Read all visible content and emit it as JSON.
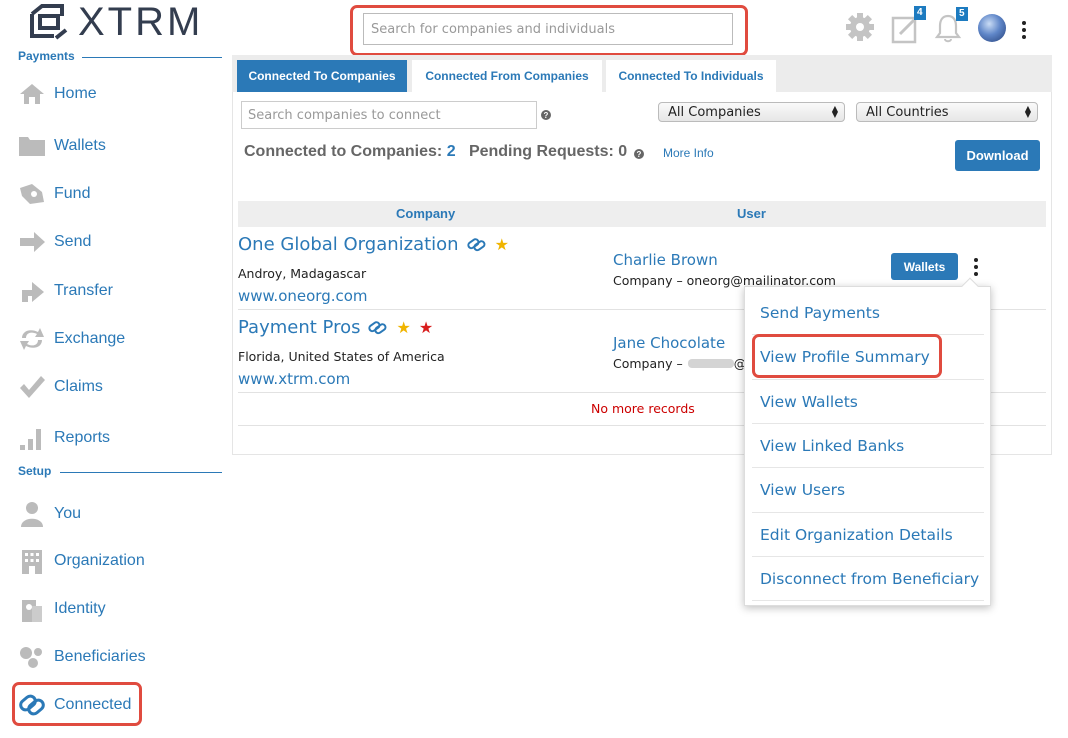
{
  "header": {
    "logo_text": "XTRM",
    "search_placeholder": "Search for companies and individuals",
    "notes_badge": "4",
    "notifications_badge": "5",
    "icons": [
      "gear-icon",
      "notes-icon",
      "bell-icon",
      "avatar",
      "kebab-icon"
    ]
  },
  "sidebar": {
    "payments_title": "Payments",
    "setup_title": "Setup",
    "payments_items": [
      {
        "label": "Home",
        "icon": "home-icon"
      },
      {
        "label": "Wallets",
        "icon": "folder-icon"
      },
      {
        "label": "Fund",
        "icon": "fund-icon"
      },
      {
        "label": "Send",
        "icon": "send-arrow-icon"
      },
      {
        "label": "Transfer",
        "icon": "transfer-arrow-icon"
      },
      {
        "label": "Exchange",
        "icon": "exchange-icon"
      },
      {
        "label": "Claims",
        "icon": "checkmark-icon"
      },
      {
        "label": "Reports",
        "icon": "bar-chart-icon"
      }
    ],
    "setup_items": [
      {
        "label": "You",
        "icon": "person-icon"
      },
      {
        "label": "Organization",
        "icon": "building-icon"
      },
      {
        "label": "Identity",
        "icon": "identity-icon"
      },
      {
        "label": "Beneficiaries",
        "icon": "beneficiaries-icon"
      },
      {
        "label": "Connected",
        "icon": "link-icon"
      }
    ]
  },
  "tabs": [
    {
      "label": "Connected To Companies",
      "active": true
    },
    {
      "label": "Connected From Companies",
      "active": false
    },
    {
      "label": "Connected To Individuals",
      "active": false
    }
  ],
  "filters": {
    "search_placeholder": "Search companies to connect",
    "help": "?",
    "company_select": "All Companies",
    "country_select": "All Countries"
  },
  "summary": {
    "connected_label": "Connected to Companies:",
    "connected_count": "2",
    "pending_label": "Pending Requests:",
    "pending_count": "0",
    "more_info": "More Info",
    "download": "Download"
  },
  "table": {
    "headers": [
      "Company",
      "User"
    ],
    "rows": [
      {
        "company": "One Global Organization",
        "location": "Androy, Madagascar",
        "website": "www.oneorg.com",
        "user": "Charlie Brown",
        "user_detail": "Company – oneorg@mailinator.com",
        "wallets_button": "Wallets"
      },
      {
        "company": "Payment Pros",
        "location": "Florida, United States of America",
        "website": "www.xtrm.com",
        "user": "Jane Chocolate",
        "user_detail_prefix": "Company –",
        "user_detail_suffix": "@xtr"
      }
    ],
    "no_more": "No more records"
  },
  "dropdown": {
    "items": [
      "Send Payments",
      "View Profile Summary",
      "View Wallets",
      "View Linked Banks",
      "View Users",
      "Edit Organization Details",
      "Disconnect from Beneficiary"
    ]
  },
  "colors": {
    "accent": "#2b79b7",
    "highlight_ring": "#e04b3f",
    "no_more_text": "#cc0000",
    "star_gold": "#f0b400",
    "star_red": "#d81e1e"
  }
}
